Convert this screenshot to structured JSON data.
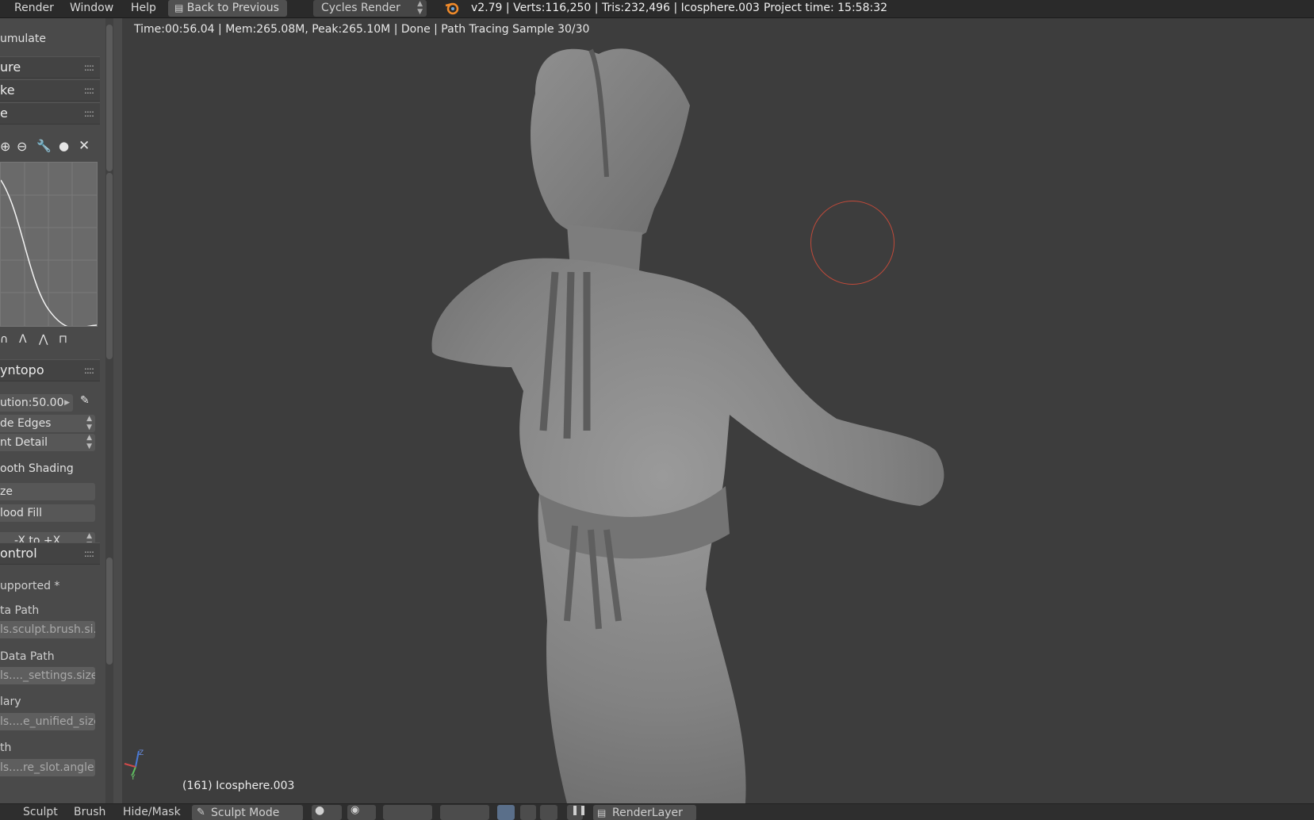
{
  "topbar": {
    "menus": [
      "Render",
      "Window",
      "Help"
    ],
    "back_button": "Back to Previous",
    "engine": "Cycles Render",
    "stats": "v2.79 | Verts:116,250 | Tris:232,496 | Icosphere.003",
    "project_time": "Project time: 15:58:32"
  },
  "shelf": {
    "accumulate": "umulate",
    "panels": [
      "ure",
      "ke",
      "e"
    ],
    "dyntopo_header": "yntopo",
    "detail_size": "ution:",
    "detail_value": "50.00",
    "subdivide": "de Edges",
    "detail_mode": "nt Detail",
    "smooth_shading": "ooth Shading",
    "optimize": "ze",
    "flood_fill": "lood Fill",
    "symmetrize": "-X to +X",
    "control_header": "ontrol",
    "unsupported": "upported *",
    "data_path_label": "ta Path",
    "data_path_value": "ls.sculpt.brush.si...",
    "data_path2_label": "Data Path",
    "data_path2_value": "ls...._settings.size",
    "secondary_label": "lary",
    "secondary_value": "ls....e_unified_size",
    "path_label": "th",
    "path_value": "ls....re_slot.angle"
  },
  "viewport": {
    "render_status": "Time:00:56.04 | Mem:265.08M, Peak:265.10M | Done | Path Tracing Sample 30/30",
    "object_label": "(161) Icosphere.003",
    "axes": {
      "z": "Z",
      "y": "Y"
    }
  },
  "bottombar": {
    "items": [
      "Sculpt",
      "Brush",
      "Hide/Mask"
    ],
    "mode": "Sculpt Mode",
    "render_layer": "RenderLayer"
  },
  "colors": {
    "viewport_bg": "#3d3d3d",
    "brush_circle": "#c04a3a",
    "shelf_bg": "#4a4a4a"
  }
}
